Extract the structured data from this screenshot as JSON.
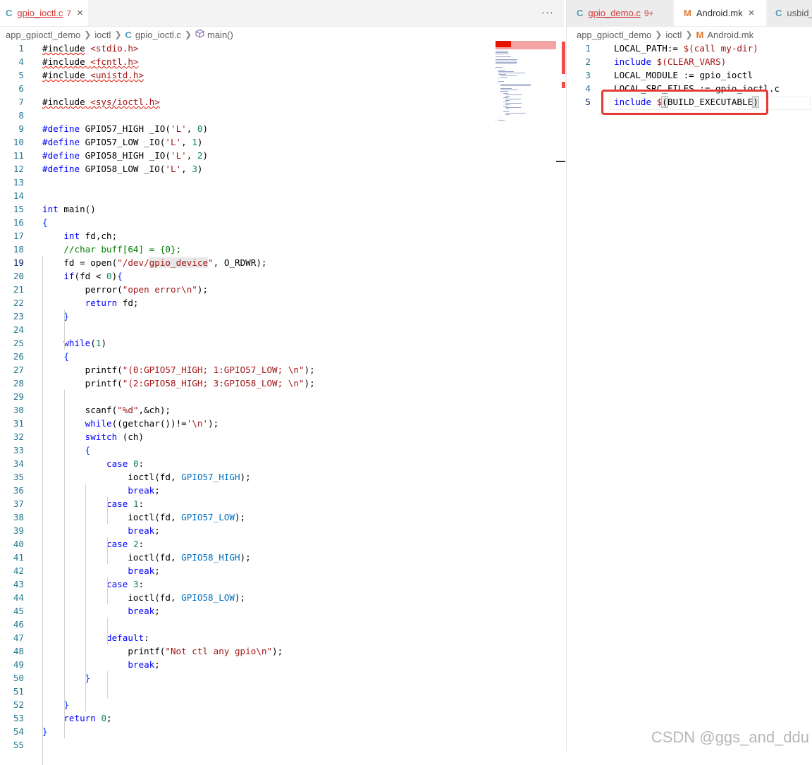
{
  "left": {
    "tabs": [
      {
        "icon": "C",
        "label": "gpio_ioctl.c",
        "badge": "7",
        "close": "×",
        "active": true
      }
    ],
    "more_actions": "···",
    "breadcrumb": [
      "app_gpioctl_demo",
      "ioctl",
      "gpio_ioctl.c",
      "main()"
    ],
    "breadcrumb_file_icon": "C",
    "lines": [
      {
        "n": "1",
        "html": "<span class='squig'>#include</span> <span class='str'>&lt;stdio.h&gt;</span>"
      },
      {
        "n": "4",
        "html": "<span class='squig'>#include <span class='str'>&lt;fcntl.h&gt;</span></span>"
      },
      {
        "n": "5",
        "html": "<span class='squig'>#include <span class='str'>&lt;unistd.h&gt;</span></span>"
      },
      {
        "n": "6",
        "html": ""
      },
      {
        "n": "7",
        "html": "<span class='squig'>#include <span class='str'>&lt;sys/ioctl.h&gt;</span></span>"
      },
      {
        "n": "8",
        "html": ""
      },
      {
        "n": "9",
        "html": "<span class='kw'>#define</span> GPIO57_HIGH _IO(<span class='str'>'L'</span>, <span class='num'>0</span>)"
      },
      {
        "n": "10",
        "html": "<span class='kw'>#define</span> GPIO57_LOW _IO(<span class='str'>'L'</span>, <span class='num'>1</span>)"
      },
      {
        "n": "11",
        "html": "<span class='kw'>#define</span> GPIO58_HIGH _IO(<span class='str'>'L'</span>, <span class='num'>2</span>)"
      },
      {
        "n": "12",
        "html": "<span class='kw'>#define</span> GPIO58_LOW _IO(<span class='str'>'L'</span>, <span class='num'>3</span>)"
      },
      {
        "n": "13",
        "html": ""
      },
      {
        "n": "14",
        "html": ""
      },
      {
        "n": "15",
        "html": "<span class='kw'>int</span> main()"
      },
      {
        "n": "16",
        "html": "<span class='br'>{</span>"
      },
      {
        "n": "17",
        "html": "    <span class='kw'>int</span> fd,ch;"
      },
      {
        "n": "18",
        "html": "    <span class='cm'>//char buff[64] = {0};</span>"
      },
      {
        "n": "19",
        "html": "    fd = open(<span class='str'>\"/dev/<span class='hl'>gpio_device</span>\"</span>, O_RDWR);"
      },
      {
        "n": "20",
        "html": "    <span class='kw'>if</span>(fd &lt; <span class='num'>0</span>)<span class='br'>{</span>"
      },
      {
        "n": "21",
        "html": "        perror(<span class='str'>\"open error\\n\"</span>);"
      },
      {
        "n": "22",
        "html": "        <span class='kw'>return</span> fd;"
      },
      {
        "n": "23",
        "html": "    <span class='br'>}</span>"
      },
      {
        "n": "24",
        "html": ""
      },
      {
        "n": "25",
        "html": "    <span class='kw'>while</span>(<span class='num'>1</span>)"
      },
      {
        "n": "26",
        "html": "    <span class='br'>{</span>"
      },
      {
        "n": "27",
        "html": "        printf(<span class='str'>\"(0:GPIO57_HIGH; 1:GPIO57_LOW; \\n\"</span>);"
      },
      {
        "n": "28",
        "html": "        printf(<span class='str'>\"(2:GPIO58_HIGH; 3:GPIO58_LOW; \\n\"</span>);"
      },
      {
        "n": "29",
        "html": ""
      },
      {
        "n": "30",
        "html": "        scanf(<span class='str'>\"%d\"</span>,&amp;ch);"
      },
      {
        "n": "31",
        "html": "        <span class='kw'>while</span>((getchar())!=<span class='str'>'\\n'</span>);"
      },
      {
        "n": "32",
        "html": "        <span class='kw'>switch</span> (ch)"
      },
      {
        "n": "33",
        "html": "        <span class='br'>{</span>"
      },
      {
        "n": "34",
        "html": "            <span class='kw'>case</span> <span class='num'>0</span>:"
      },
      {
        "n": "35",
        "html": "                ioctl(fd, <span class='mac'>GPIO57_HIGH</span>);"
      },
      {
        "n": "36",
        "html": "                <span class='kw'>break</span>;"
      },
      {
        "n": "37",
        "html": "            <span class='kw'>case</span> <span class='num'>1</span>:"
      },
      {
        "n": "38",
        "html": "                ioctl(fd, <span class='mac'>GPIO57_LOW</span>);"
      },
      {
        "n": "39",
        "html": "                <span class='kw'>break</span>;"
      },
      {
        "n": "40",
        "html": "            <span class='kw'>case</span> <span class='num'>2</span>:"
      },
      {
        "n": "41",
        "html": "                ioctl(fd, <span class='mac'>GPIO58_HIGH</span>);"
      },
      {
        "n": "42",
        "html": "                <span class='kw'>break</span>;"
      },
      {
        "n": "43",
        "html": "            <span class='kw'>case</span> <span class='num'>3</span>:"
      },
      {
        "n": "44",
        "html": "                ioctl(fd, <span class='mac'>GPIO58_LOW</span>);"
      },
      {
        "n": "45",
        "html": "                <span class='kw'>break</span>;"
      },
      {
        "n": "46",
        "html": ""
      },
      {
        "n": "47",
        "html": "            <span class='kw'>default</span>:"
      },
      {
        "n": "48",
        "html": "                printf(<span class='str'>\"Not ctl any gpio\\n\"</span>);"
      },
      {
        "n": "49",
        "html": "                <span class='kw'>break</span>;"
      },
      {
        "n": "50",
        "html": "        <span class='br'>}</span>"
      },
      {
        "n": "51",
        "html": ""
      },
      {
        "n": "52",
        "html": "    <span class='br'>}</span>"
      },
      {
        "n": "53",
        "html": "    <span class='kw'>return</span> <span class='num'>0</span>;"
      },
      {
        "n": "54",
        "html": "<span class='br'>}</span>"
      },
      {
        "n": "55",
        "html": ""
      }
    ],
    "current_line": "19"
  },
  "right": {
    "tabs": [
      {
        "icon": "C",
        "label": "gpio_demo.c",
        "badge": "9+",
        "close": "",
        "active": false
      },
      {
        "icon": "M",
        "label": "Android.mk",
        "badge": "",
        "close": "×",
        "active": true
      },
      {
        "icon": "C",
        "label": "usbid_",
        "badge": "",
        "close": "",
        "active": false
      }
    ],
    "breadcrumb": [
      "app_gpioctl_demo",
      "ioctl",
      "Android.mk"
    ],
    "breadcrumb_file_icon": "M",
    "lines": [
      {
        "n": "1",
        "html": "LOCAL_PATH:= <span class='str'>$(call my-dir)</span>"
      },
      {
        "n": "2",
        "html": "<span class='kw'>include</span> <span class='str'>$(CLEAR_VARS)</span>"
      },
      {
        "n": "3",
        "html": "LOCAL_MODULE := gpio_ioctl"
      },
      {
        "n": "4",
        "html": "LOCAL_SRC_FILES := gpio_ioctl.c"
      },
      {
        "n": "5",
        "html": "<span class='kw'>include</span> <span class='str'>$</span><span class='hl' style='outline:1px solid #b9b9b9'>(</span>BUILD_EXECUTABLE<span class='hl' style='outline:1px solid #b9b9b9'>)</span>"
      }
    ],
    "current_line": "5"
  },
  "watermark": "CSDN @ggs_and_ddu"
}
